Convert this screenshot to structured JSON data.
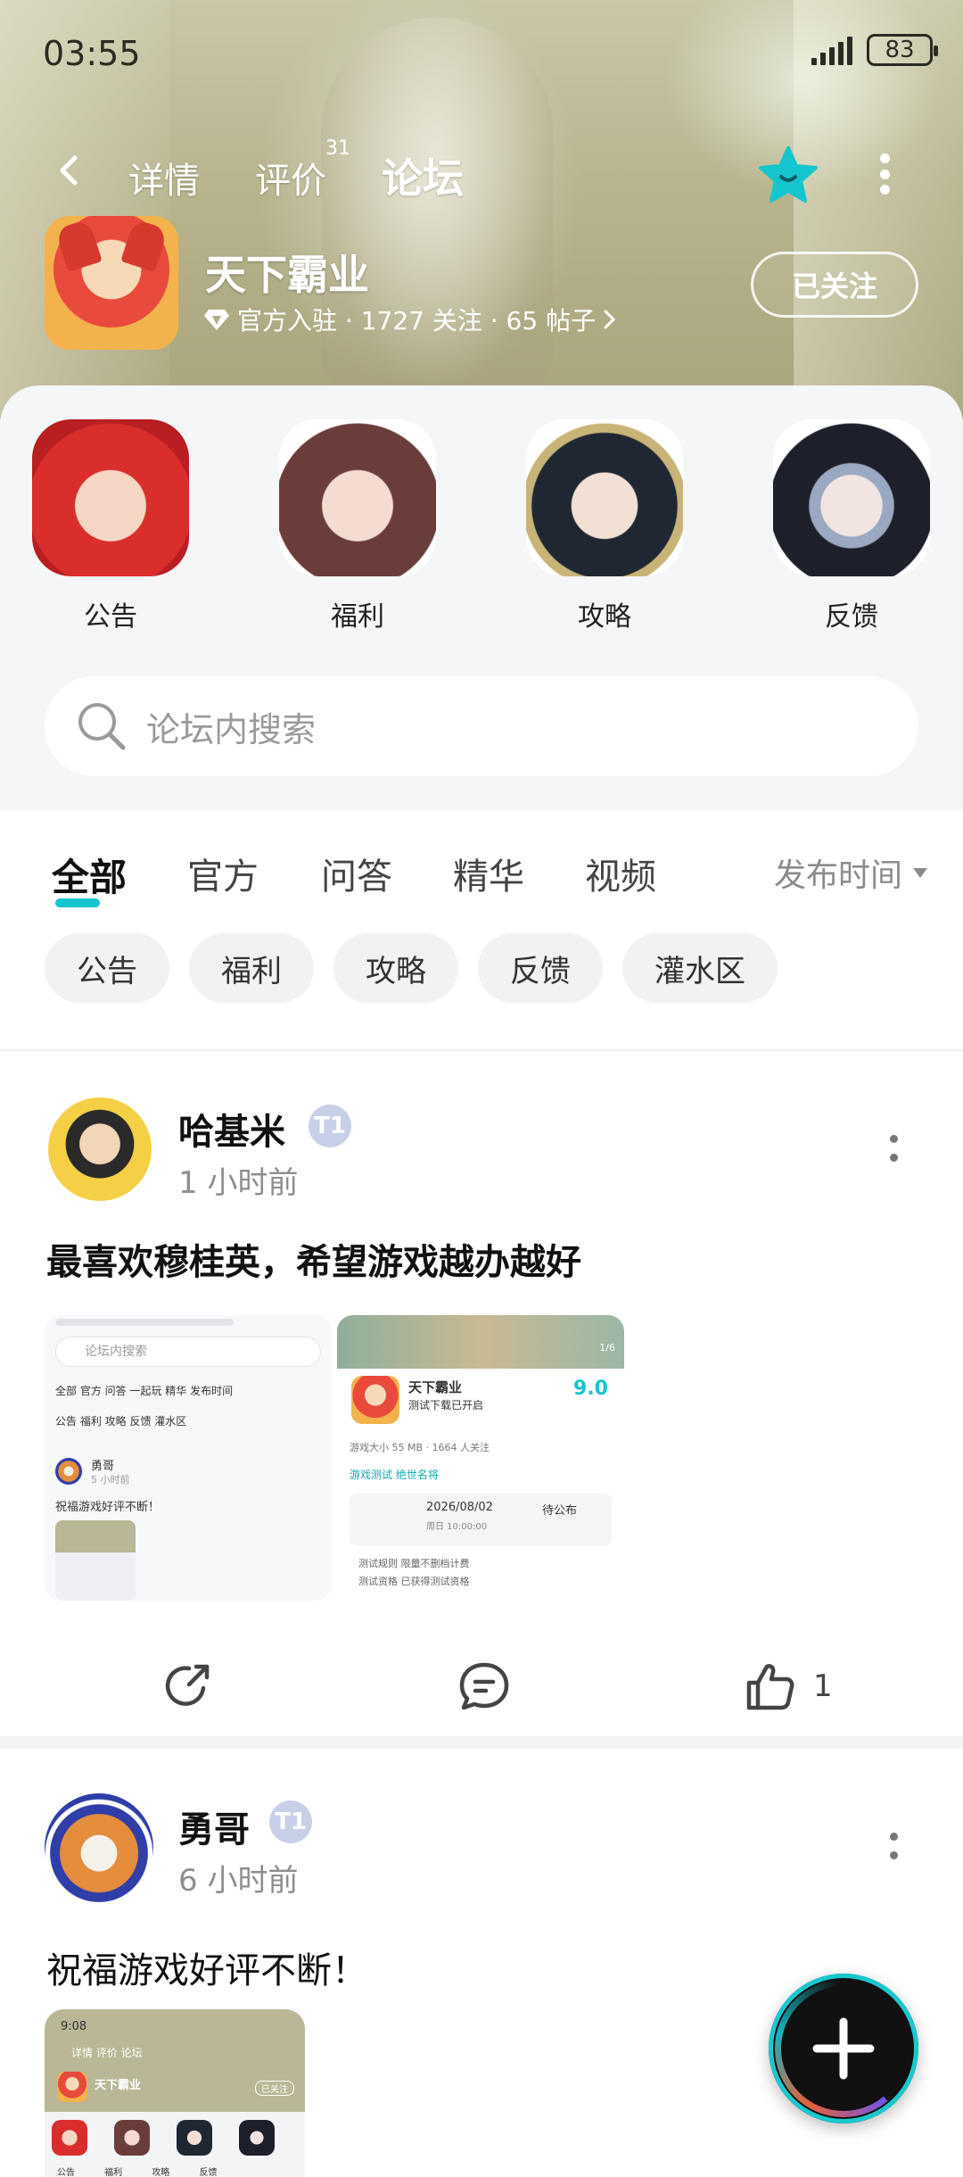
{
  "status_bar": {
    "time": "03:55",
    "battery": "83"
  },
  "nav": {
    "tabs": [
      {
        "label": "详情"
      },
      {
        "label": "评价",
        "badge": "31"
      },
      {
        "label": "论坛"
      }
    ]
  },
  "game": {
    "name": "天下霸业",
    "meta": "官方入驻 · 1727 关注 · 65 帖子",
    "follow_label": "已关注"
  },
  "quick_links": [
    {
      "label": "公告"
    },
    {
      "label": "福利"
    },
    {
      "label": "攻略"
    },
    {
      "label": "反馈"
    }
  ],
  "search": {
    "placeholder": "论坛内搜索"
  },
  "filter_tabs": [
    {
      "label": "全部"
    },
    {
      "label": "官方"
    },
    {
      "label": "问答"
    },
    {
      "label": "精华"
    },
    {
      "label": "视频"
    }
  ],
  "sort_label": "发布时间",
  "chips": [
    {
      "label": "公告"
    },
    {
      "label": "福利"
    },
    {
      "label": "攻略"
    },
    {
      "label": "反馈"
    },
    {
      "label": "灌水区"
    }
  ],
  "posts": [
    {
      "author": "哈基米",
      "badge": "T1",
      "time": "1 小时前",
      "title": "最喜欢穆桂英，希望游戏越办越好",
      "like_count": "1",
      "shot_a": {
        "search": "论坛内搜索",
        "tabs": "全部  官方  问答  一起玩  精华  发布时间",
        "chips": "公告  福利  攻略  反馈  灌水区",
        "user": "勇哥",
        "time": "5 小时前",
        "text": "祝福游戏好评不断！"
      },
      "shot_b": {
        "name": "天下霸业",
        "sub": "测试下载已开启",
        "score": "9.0",
        "info": "游戏大小 55 MB · 1664 人关注",
        "test_tag": "游戏测试  绝世名将",
        "date": "2026/08/02",
        "date_sub": "周日 10:00:00",
        "result": "待公布",
        "rule": "测试规则    限量不删档计费",
        "qual": "测试资格    已获得测试资格",
        "page": "1/6"
      }
    },
    {
      "author": "勇哥",
      "badge": "T1",
      "time": "6 小时前",
      "text": "祝福游戏好评不断！",
      "shot": {
        "time": "9:08",
        "tabs": "详情  评价  论坛",
        "name": "天下霸业",
        "follow": "已关注",
        "labels": "公告   福利   攻略   反馈"
      }
    }
  ],
  "colors": {
    "accent": "#15C5CE",
    "text": "#111111",
    "muted": "#8E8E8E"
  }
}
